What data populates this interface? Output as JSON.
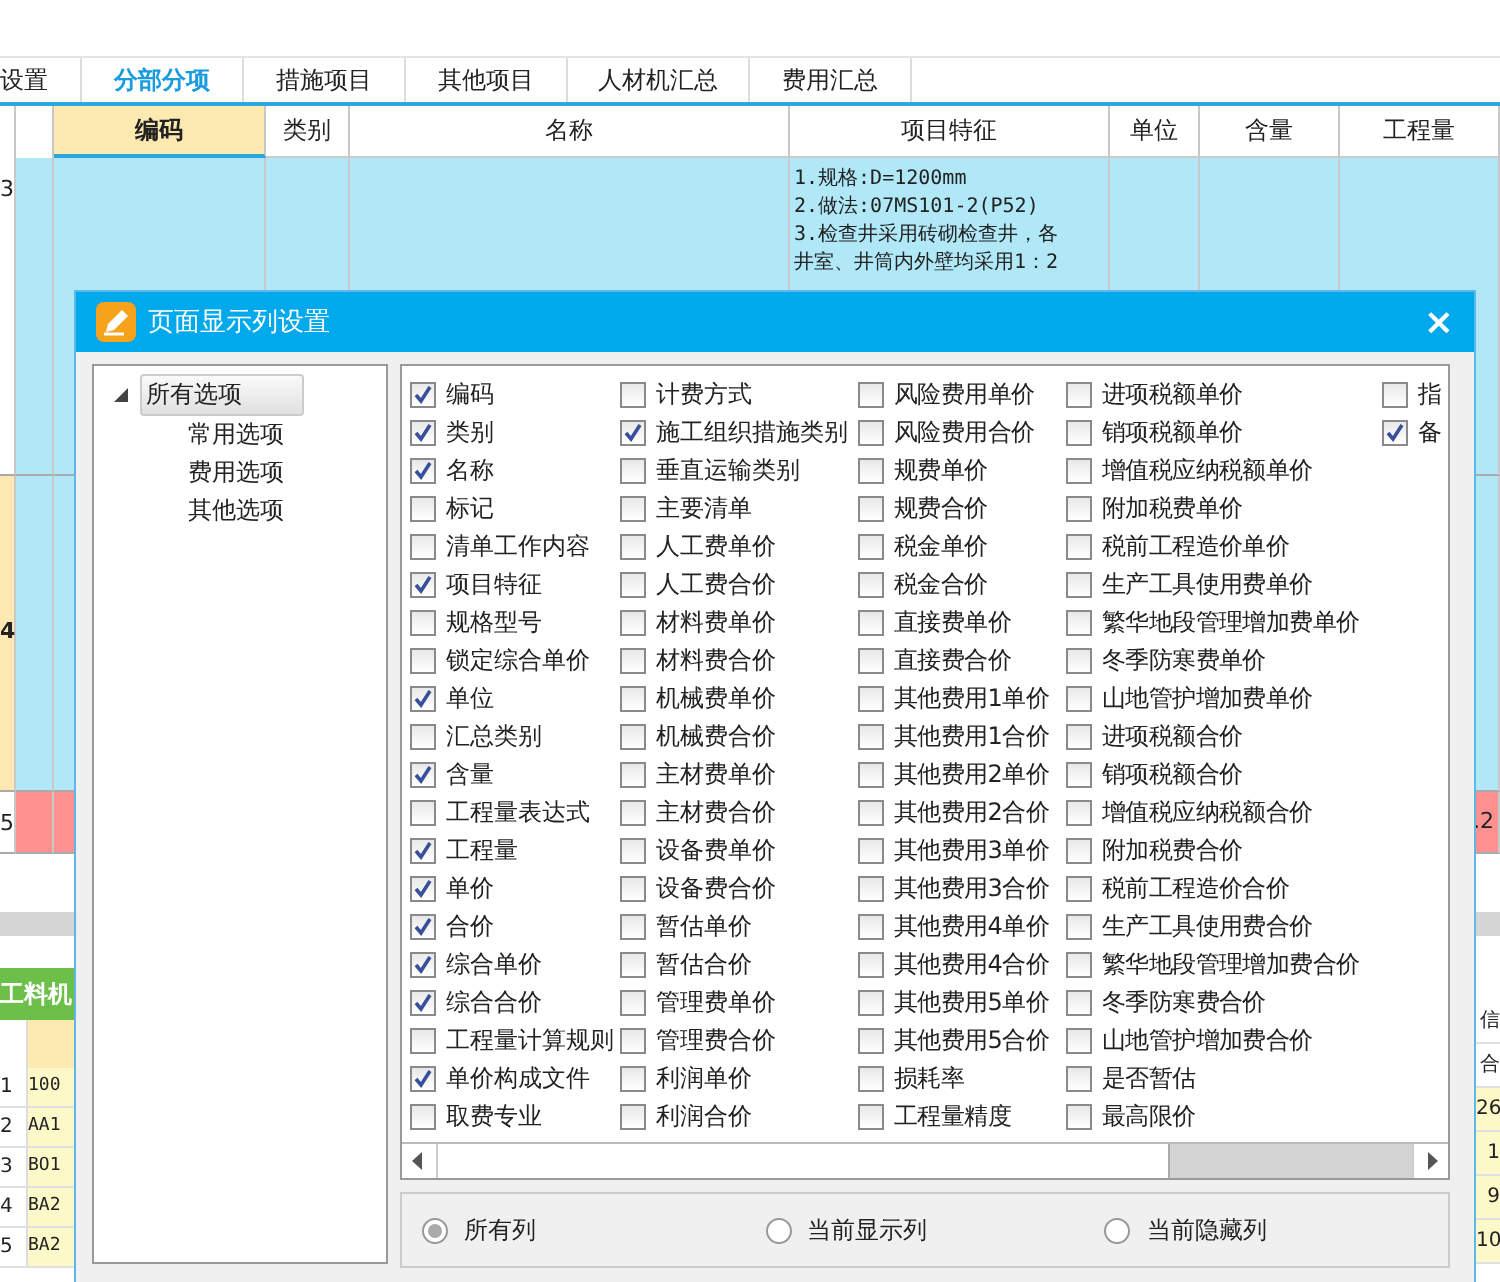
{
  "tabs": [
    {
      "label": "设置",
      "selected": false
    },
    {
      "label": "分部分项",
      "selected": true
    },
    {
      "label": "措施项目",
      "selected": false
    },
    {
      "label": "其他项目",
      "selected": false
    },
    {
      "label": "人材机汇总",
      "selected": false
    },
    {
      "label": "费用汇总",
      "selected": false
    }
  ],
  "grid": {
    "columns": [
      "编码",
      "类别",
      "名称",
      "项目特征",
      "单位",
      "含量",
      "工程量"
    ],
    "rows": [
      {
        "number": "3",
        "feature": [
          "1.规格:D=1200mm",
          "2.做法:07MS101-2(P52)",
          "3.检查井采用砖砌检查井，各",
          "井室、井筒内外壁均采用1：2"
        ]
      },
      {
        "number": "4"
      },
      {
        "number": "5",
        "quantity": ".2"
      }
    ]
  },
  "bottom": {
    "title": "工料机",
    "rows": [
      {
        "number": "1",
        "code": "100"
      },
      {
        "number": "2",
        "code": "AA1"
      },
      {
        "number": "3",
        "code": "BO1"
      },
      {
        "number": "4",
        "code": "BA2"
      },
      {
        "number": "5",
        "code": "BA2"
      }
    ],
    "right_cells": [
      "信",
      "合",
      "26",
      "1",
      "9",
      "10"
    ]
  },
  "dialog": {
    "title": "页面显示列设置",
    "close": "×",
    "tree": [
      {
        "label": "所有选项",
        "expanded": true,
        "selected": true,
        "children": [
          {
            "label": "常用选项",
            "selected": false
          },
          {
            "label": "费用选项",
            "selected": false
          },
          {
            "label": "其他选项",
            "selected": false
          }
        ]
      }
    ],
    "option_columns": [
      {
        "items": [
          {
            "label": "编码",
            "checked": true
          },
          {
            "label": "类别",
            "checked": true
          },
          {
            "label": "名称",
            "checked": true
          },
          {
            "label": "标记",
            "checked": false
          },
          {
            "label": "清单工作内容",
            "checked": false
          },
          {
            "label": "项目特征",
            "checked": true
          },
          {
            "label": "规格型号",
            "checked": false
          },
          {
            "label": "锁定综合单价",
            "checked": false
          },
          {
            "label": "单位",
            "checked": true
          },
          {
            "label": "汇总类别",
            "checked": false
          },
          {
            "label": "含量",
            "checked": true
          },
          {
            "label": "工程量表达式",
            "checked": false
          },
          {
            "label": "工程量",
            "checked": true
          },
          {
            "label": "单价",
            "checked": true
          },
          {
            "label": "合价",
            "checked": true
          },
          {
            "label": "综合单价",
            "checked": true
          },
          {
            "label": "综合合价",
            "checked": true
          },
          {
            "label": "工程量计算规则",
            "checked": false
          },
          {
            "label": "单价构成文件",
            "checked": true
          },
          {
            "label": "取费专业",
            "checked": false
          }
        ]
      },
      {
        "items": [
          {
            "label": "计费方式",
            "checked": false
          },
          {
            "label": "施工组织措施类别",
            "checked": true
          },
          {
            "label": "垂直运输类别",
            "checked": false
          },
          {
            "label": "主要清单",
            "checked": false
          },
          {
            "label": "人工费单价",
            "checked": false
          },
          {
            "label": "人工费合价",
            "checked": false
          },
          {
            "label": "材料费单价",
            "checked": false
          },
          {
            "label": "材料费合价",
            "checked": false
          },
          {
            "label": "机械费单价",
            "checked": false
          },
          {
            "label": "机械费合价",
            "checked": false
          },
          {
            "label": "主材费单价",
            "checked": false
          },
          {
            "label": "主材费合价",
            "checked": false
          },
          {
            "label": "设备费单价",
            "checked": false
          },
          {
            "label": "设备费合价",
            "checked": false
          },
          {
            "label": "暂估单价",
            "checked": false
          },
          {
            "label": "暂估合价",
            "checked": false
          },
          {
            "label": "管理费单价",
            "checked": false
          },
          {
            "label": "管理费合价",
            "checked": false
          },
          {
            "label": "利润单价",
            "checked": false
          },
          {
            "label": "利润合价",
            "checked": false
          }
        ]
      },
      {
        "items": [
          {
            "label": "风险费用单价",
            "checked": false
          },
          {
            "label": "风险费用合价",
            "checked": false
          },
          {
            "label": "规费单价",
            "checked": false
          },
          {
            "label": "规费合价",
            "checked": false
          },
          {
            "label": "税金单价",
            "checked": false
          },
          {
            "label": "税金合价",
            "checked": false
          },
          {
            "label": "直接费单价",
            "checked": false
          },
          {
            "label": "直接费合价",
            "checked": false
          },
          {
            "label": "其他费用1单价",
            "checked": false
          },
          {
            "label": "其他费用1合价",
            "checked": false
          },
          {
            "label": "其他费用2单价",
            "checked": false
          },
          {
            "label": "其他费用2合价",
            "checked": false
          },
          {
            "label": "其他费用3单价",
            "checked": false
          },
          {
            "label": "其他费用3合价",
            "checked": false
          },
          {
            "label": "其他费用4单价",
            "checked": false
          },
          {
            "label": "其他费用4合价",
            "checked": false
          },
          {
            "label": "其他费用5单价",
            "checked": false
          },
          {
            "label": "其他费用5合价",
            "checked": false
          },
          {
            "label": "损耗率",
            "checked": false
          },
          {
            "label": "工程量精度",
            "checked": false
          }
        ]
      },
      {
        "items": [
          {
            "label": "进项税额单价",
            "checked": false
          },
          {
            "label": "销项税额单价",
            "checked": false
          },
          {
            "label": "增值税应纳税额单价",
            "checked": false
          },
          {
            "label": "附加税费单价",
            "checked": false
          },
          {
            "label": "税前工程造价单价",
            "checked": false
          },
          {
            "label": "生产工具使用费单价",
            "checked": false
          },
          {
            "label": "繁华地段管理增加费单价",
            "checked": false
          },
          {
            "label": "冬季防寒费单价",
            "checked": false
          },
          {
            "label": "山地管护增加费单价",
            "checked": false
          },
          {
            "label": "进项税额合价",
            "checked": false
          },
          {
            "label": "销项税额合价",
            "checked": false
          },
          {
            "label": "增值税应纳税额合价",
            "checked": false
          },
          {
            "label": "附加税费合价",
            "checked": false
          },
          {
            "label": "税前工程造价合价",
            "checked": false
          },
          {
            "label": "生产工具使用费合价",
            "checked": false
          },
          {
            "label": "繁华地段管理增加费合价",
            "checked": false
          },
          {
            "label": "冬季防寒费合价",
            "checked": false
          },
          {
            "label": "山地管护增加费合价",
            "checked": false
          },
          {
            "label": "是否暂估",
            "checked": false
          },
          {
            "label": "最高限价",
            "checked": false
          }
        ]
      },
      {
        "items": [
          {
            "label": "指",
            "checked": false
          },
          {
            "label": "备",
            "checked": true
          }
        ]
      }
    ],
    "radios": [
      {
        "label": "所有列",
        "selected": true
      },
      {
        "label": "当前显示列",
        "selected": false
      },
      {
        "label": "当前隐藏列",
        "selected": false
      }
    ]
  }
}
